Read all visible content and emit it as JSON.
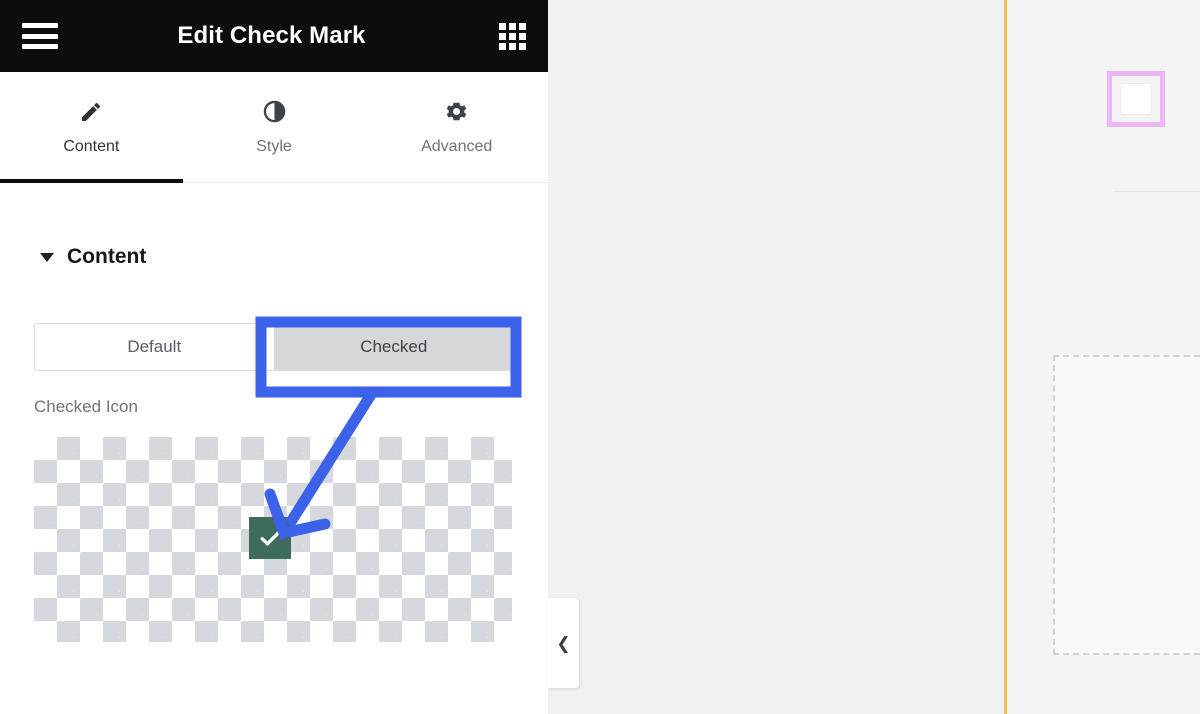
{
  "panel": {
    "header": {
      "title": "Edit Check Mark",
      "menu_icon": "hamburger-menu-icon",
      "grid_icon": "apps-grid-icon"
    },
    "tabs": [
      {
        "label": "Content",
        "icon": "pencil-icon",
        "active": true
      },
      {
        "label": "Style",
        "icon": "contrast-half-circle-icon",
        "active": false
      },
      {
        "label": "Advanced",
        "icon": "gear-icon",
        "active": false
      }
    ],
    "section": {
      "title": "Content",
      "caret_icon": "caret-down-icon"
    },
    "state_toggle": {
      "options": [
        {
          "label": "Default",
          "selected": false
        },
        {
          "label": "Checked",
          "selected": true
        }
      ]
    },
    "checked_icon_field": {
      "label": "Checked Icon",
      "preview_icon": "check-mark-icon",
      "preview_icon_color": "#3e6b5c",
      "preview_background": "transparency-checkerboard"
    },
    "collapse_handle": {
      "icon": "chevron-left-icon"
    }
  },
  "canvas": {
    "selected_widget": {
      "name": "checkbox-widget",
      "outline_color": "#eab6f7"
    },
    "drop_zone": {
      "name": "empty-drop-area"
    },
    "frame_accent_color": "#f0c04a"
  },
  "annotation": {
    "highlight_color": "#3b62e8",
    "highlight_target": "Checked",
    "arrow_points_to": "check-mark-icon"
  }
}
